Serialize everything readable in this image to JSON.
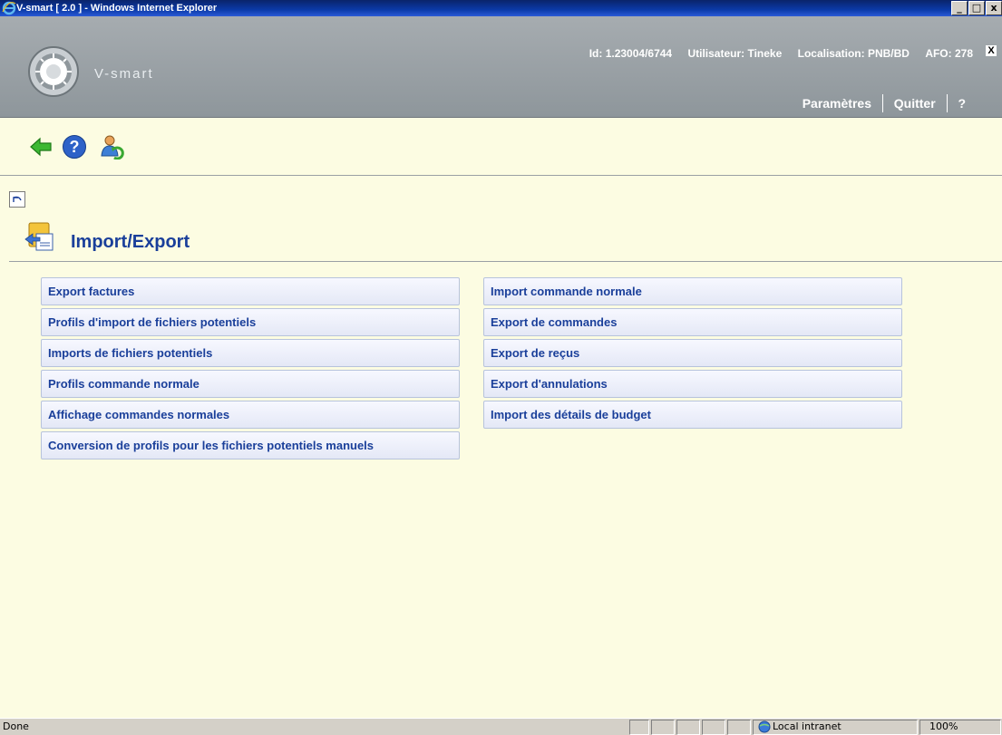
{
  "window": {
    "title": "V-smart [ 2.0 ] - Windows Internet Explorer",
    "buttons": [
      "_",
      "□",
      "x"
    ]
  },
  "header": {
    "brand": "V-smart",
    "id_label": "Id: 1.23004/6744",
    "user_label": "Utilisateur: Tineke",
    "location_label": "Localisation: PNB/BD",
    "afo_label": "AFO: 278",
    "close_label": "X",
    "links": {
      "params": "Paramètres",
      "quit": "Quitter",
      "help": "?"
    }
  },
  "page": {
    "title": "Import/Export"
  },
  "menu": {
    "left": [
      "Export factures",
      "Profils d'import de fichiers potentiels",
      "Imports de fichiers potentiels",
      "Profils commande normale",
      "Affichage commandes normales",
      "Conversion de profils pour les fichiers potentiels manuels"
    ],
    "right": [
      "Import commande normale",
      "Export de commandes",
      "Export de reçus",
      "Export d'annulations",
      "Import des détails de budget"
    ]
  },
  "status": {
    "text": "Done",
    "zone": "Local intranet",
    "zoom": "100%"
  },
  "colors": {
    "link_blue": "#1a3f9a",
    "page_bg": "#fcfce2",
    "header_gray": "#98a0a5"
  },
  "icons": {
    "back": "arrow-left-icon",
    "help": "question-icon",
    "user": "user-switch-icon",
    "small_back": "undo-icon",
    "page": "import-export-icon"
  }
}
